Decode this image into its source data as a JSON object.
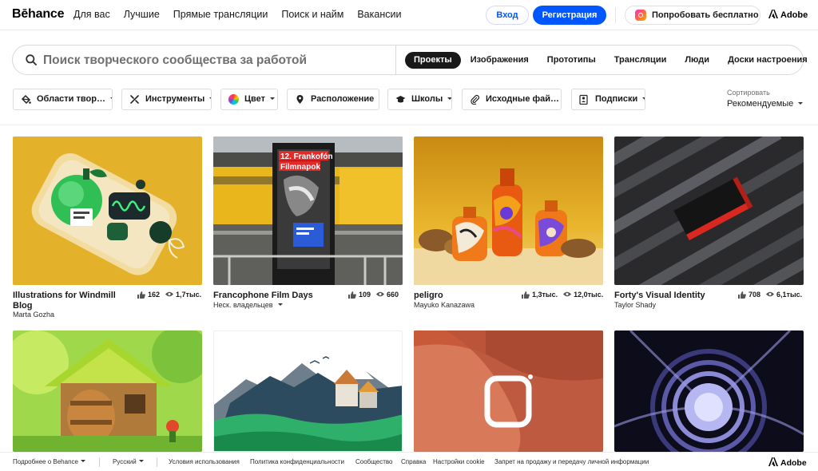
{
  "topnav": {
    "logo": "Bēhance",
    "links": [
      "Для вас",
      "Лучшие",
      "Прямые трансляции",
      "Поиск и найм",
      "Вакансии"
    ],
    "login": "Вход",
    "signup": "Регистрация",
    "try_free": "Попробовать бесплатно",
    "adobe": "Adobe"
  },
  "search": {
    "placeholder": "Поиск творческого сообщества за работой",
    "tabs": [
      "Проекты",
      "Изображения",
      "Прототипы",
      "Трансляции",
      "Люди",
      "Доски настроения"
    ],
    "active_tab": "Проекты"
  },
  "filters": {
    "items": [
      "Области твор…",
      "Инструменты",
      "Цвет",
      "Расположение",
      "Школы",
      "Исходные фай…",
      "Подписки"
    ],
    "sort_label": "Сортировать",
    "sort_value": "Рекомендуемые"
  },
  "projects": [
    {
      "title": "Illustrations for Windmill Blog",
      "owner": "Marta Gozha",
      "likes": "162",
      "views": "1,7тыс."
    },
    {
      "title": "Francophone Film Days",
      "owner": "Неск. владельцев",
      "likes": "109",
      "views": "660"
    },
    {
      "title": "peligro",
      "owner": "Mayuko Kanazawa",
      "likes": "1,3тыс.",
      "views": "12,0тыс."
    },
    {
      "title": "Forty's Visual Identity",
      "owner": "Taylor Shady",
      "likes": "708",
      "views": "6,1тыс."
    }
  ],
  "poster_text": {
    "line1": "12. Frankofón",
    "line2": "Filmnapok"
  },
  "footer": {
    "more": "Подробнее о Behance",
    "language": "Русский",
    "links": [
      "Условия использования",
      "Политика конфиденциальности",
      "Сообщество",
      "Справка",
      "Настройки cookie",
      "Запрет на продажу и передачу личной информации"
    ],
    "adobe": "Adobe"
  },
  "colors": {
    "accent": "#0057ff",
    "text": "#191919"
  }
}
